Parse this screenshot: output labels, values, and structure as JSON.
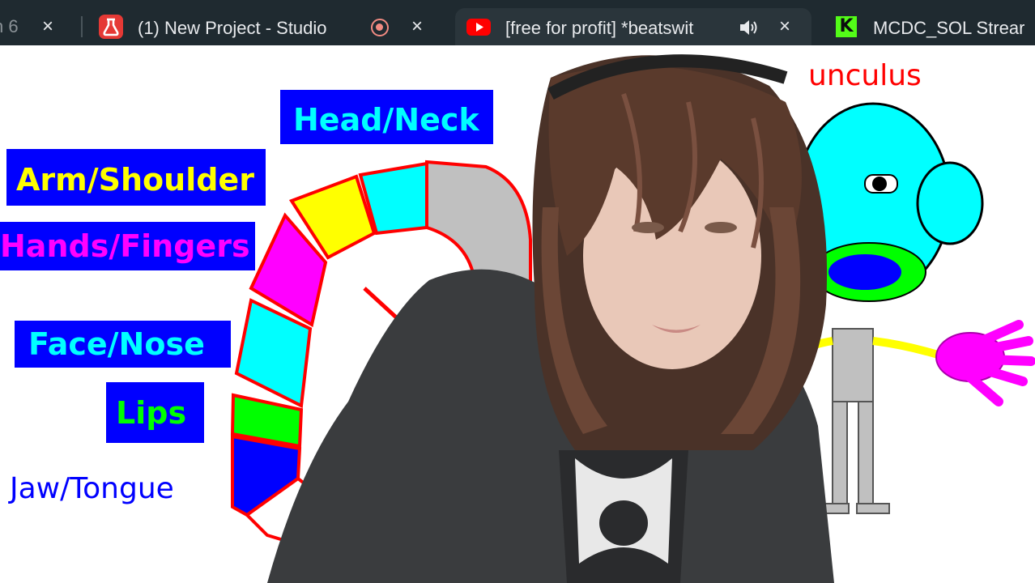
{
  "tabs": [
    {
      "title": "n 6",
      "close": "×",
      "state": "partial"
    },
    {
      "title": "(1) New Project - Studio",
      "close": "×",
      "favicon": "studio-icon",
      "indicator": "recording-icon"
    },
    {
      "title": "[free for profit] *beatswit",
      "close": "×",
      "favicon": "youtube-icon",
      "indicator": "speaker-icon",
      "active": true
    },
    {
      "title": "MCDC_SOL Strear",
      "favicon": "kick-icon",
      "favicon_letter": "K"
    }
  ],
  "diagram": {
    "title": "unculus",
    "labels": {
      "head_neck": "Head/Neck",
      "arm_shoulder": "Arm/Shoulder",
      "hands_fingers": "Hands/Fingers",
      "face_nose": "Face/Nose",
      "lips": "Lips",
      "jaw_tongue": "Jaw/Tongue"
    },
    "colors": {
      "label_box": "#0000ff",
      "head_neck_text": "#00ffff",
      "arm_shoulder_text": "#ffff00",
      "hands_fingers_text": "#ff00ff",
      "face_nose_text": "#00ffff",
      "lips_text": "#00ff00",
      "jaw_tongue_text": "#0000ff",
      "title_text": "#ff0000",
      "outline": "#ff0000"
    }
  },
  "webcam": {
    "description_icon": "person-webcam-overlay"
  }
}
